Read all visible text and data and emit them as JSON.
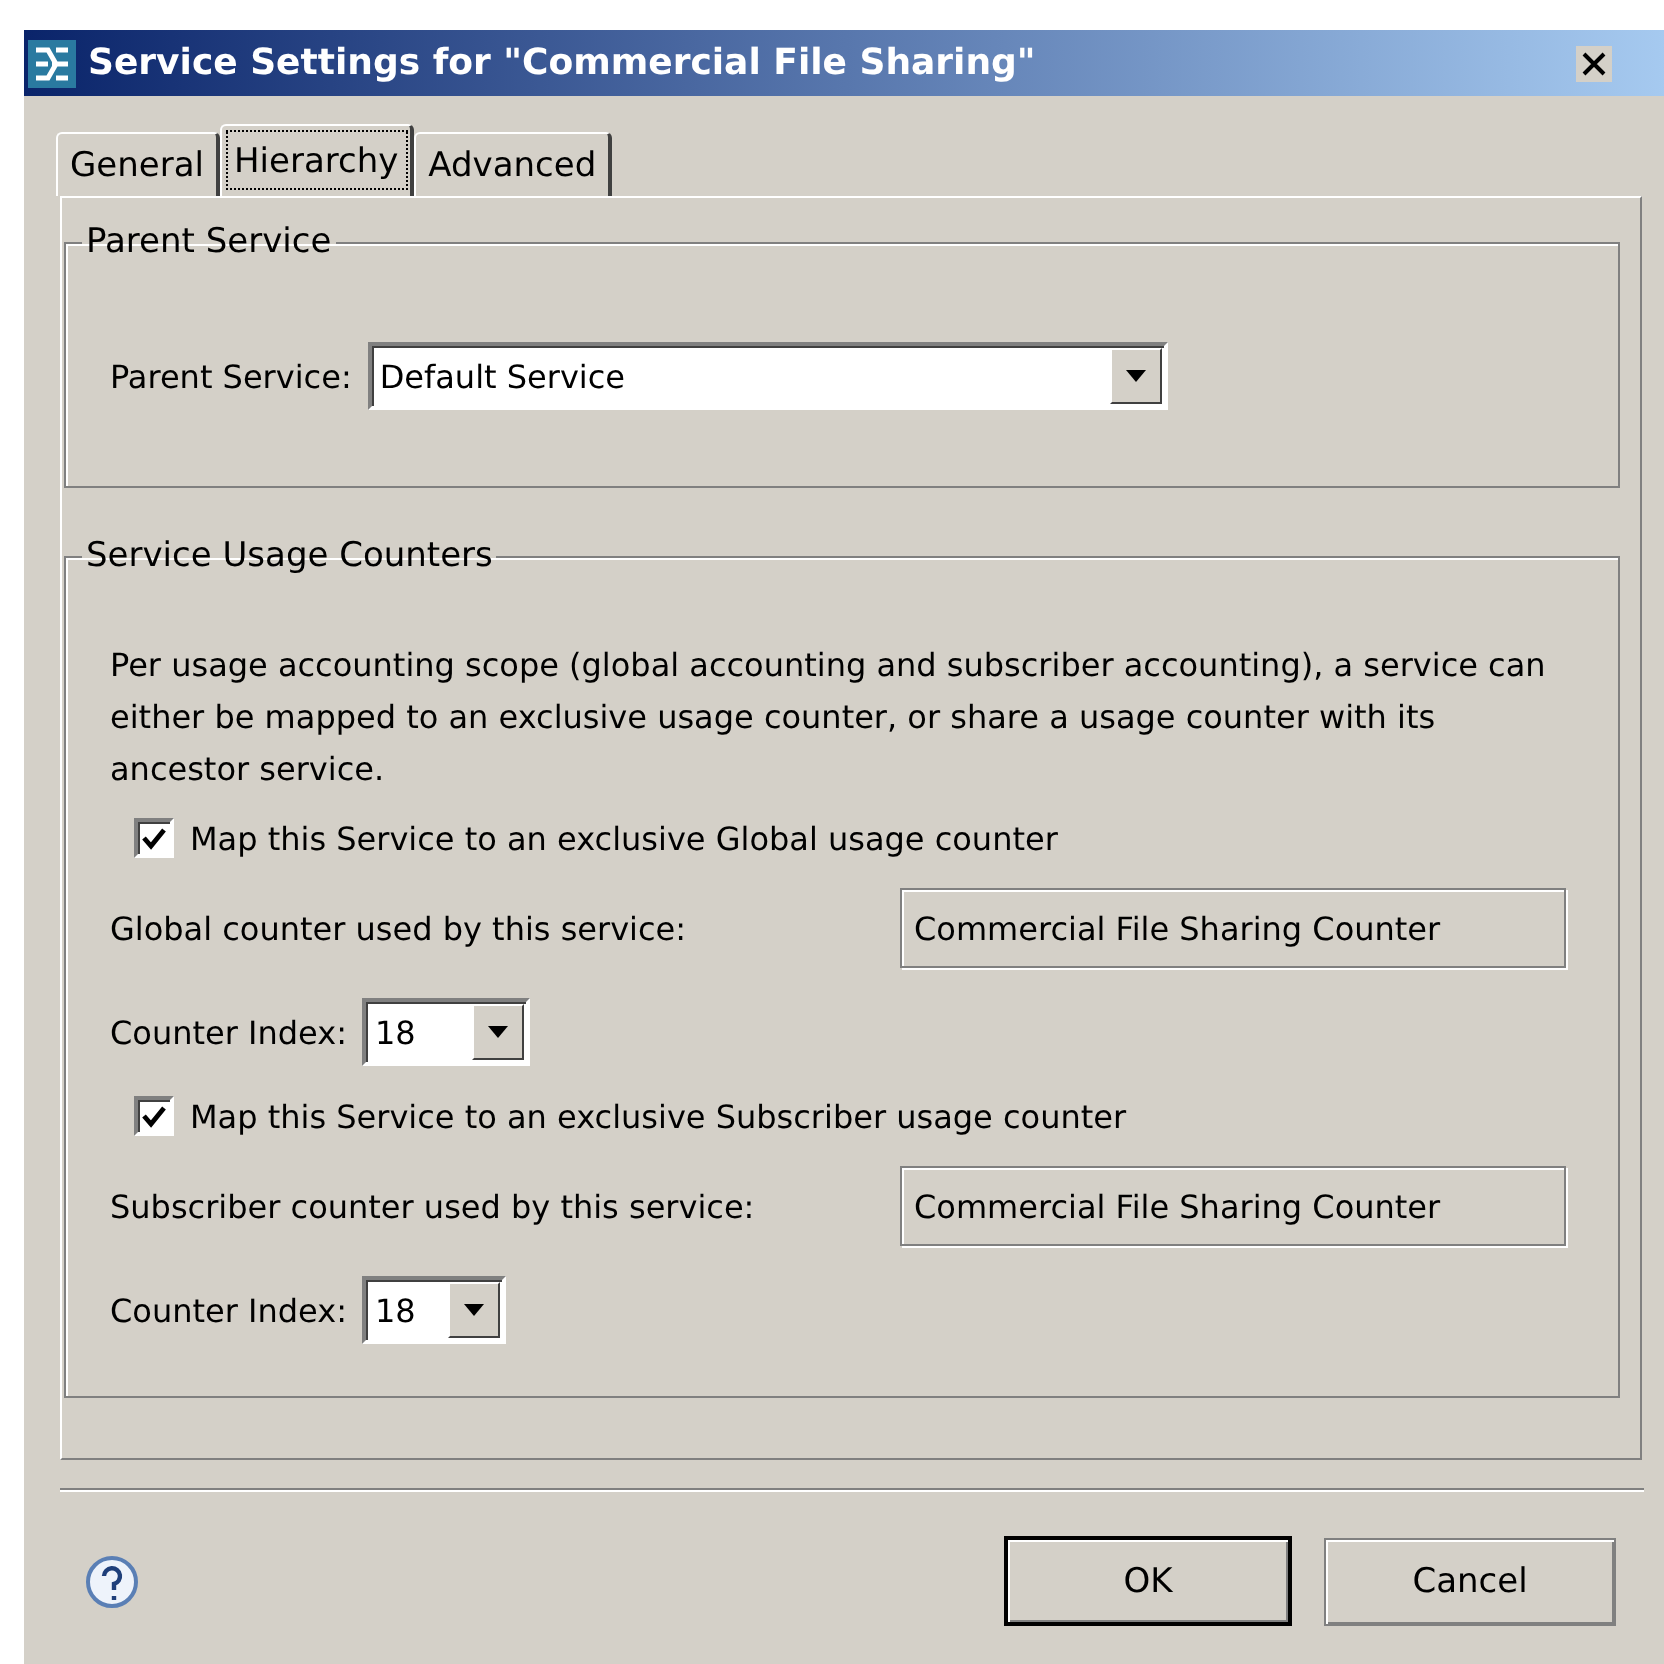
{
  "window": {
    "title": "Service Settings for \"Commercial File Sharing\""
  },
  "tabs": [
    {
      "label": "General",
      "selected": false
    },
    {
      "label": "Hierarchy",
      "selected": true
    },
    {
      "label": "Advanced",
      "selected": false
    }
  ],
  "parent_group": {
    "title": "Parent Service",
    "label": "Parent Service:",
    "value": "Default Service"
  },
  "counters_group": {
    "title": "Service Usage Counters",
    "description": "Per usage accounting scope (global accounting and subscriber accounting), a service can either be mapped to an exclusive usage counter, or share a usage counter with its ancestor service.",
    "sections": [
      {
        "checkbox_label": "Map this Service to an exclusive Global usage counter",
        "checked": true,
        "counter_label": "Global counter used by this service:",
        "counter_value": "Commercial File Sharing Counter",
        "index_label": "Counter Index:",
        "index_value": "18"
      },
      {
        "checkbox_label": "Map this Service to an exclusive Subscriber usage counter",
        "checked": true,
        "counter_label": "Subscriber counter used by this service:",
        "counter_value": "Commercial File Sharing Counter",
        "index_label": "Counter Index:",
        "index_value": "18"
      }
    ]
  },
  "buttons": [
    {
      "label": "OK",
      "default": true
    },
    {
      "label": "Cancel",
      "default": false
    }
  ]
}
